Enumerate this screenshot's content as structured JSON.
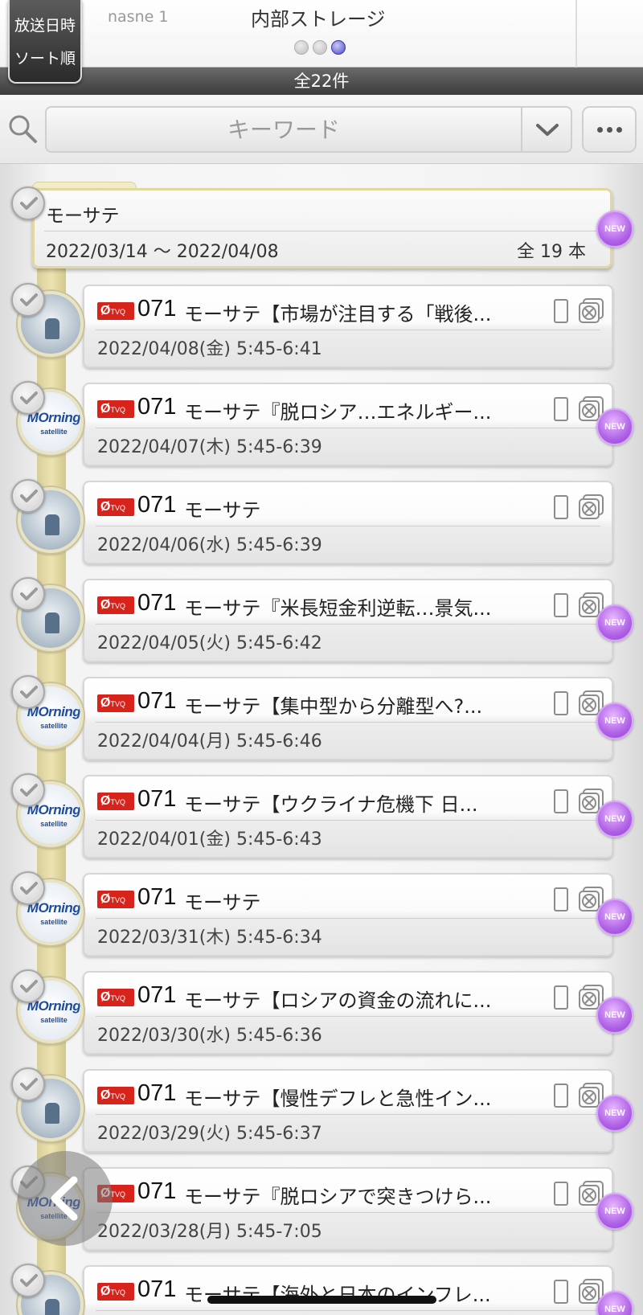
{
  "header": {
    "sort_button_line1": "放送日時",
    "sort_button_line2": "ソート順",
    "source": "nasne 1",
    "storage": "内部ストレージ",
    "total": "全22件"
  },
  "search": {
    "placeholder": "キーワード"
  },
  "colors": {
    "channel_badge": "#d8231b",
    "new_badge": "#b063e6",
    "timeline": "#e2d89f",
    "active_dot": "#4a4bc9"
  },
  "group": {
    "title": "モーサテ",
    "range": "2022/03/14 〜 2022/04/08",
    "count": "全 19 本"
  },
  "badge_new": "NEW",
  "thumb_logo": {
    "main": "MOrning",
    "sub": "satellite"
  },
  "items": [
    {
      "channel": "071",
      "title": "モーサテ【市場が注目する「戦後...",
      "time": "2022/04/08(金) 5:45-6:41",
      "new": false,
      "thumb": "studio"
    },
    {
      "channel": "071",
      "title": "モーサテ『脱ロシア…エネルギー...",
      "time": "2022/04/07(木) 5:45-6:39",
      "new": true,
      "thumb": "logo"
    },
    {
      "channel": "071",
      "title": "モーサテ",
      "time": "2022/04/06(水) 5:45-6:39",
      "new": false,
      "thumb": "studio"
    },
    {
      "channel": "071",
      "title": "モーサテ『米長短金利逆転…景気...",
      "time": "2022/04/05(火) 5:45-6:42",
      "new": true,
      "thumb": "studio"
    },
    {
      "channel": "071",
      "title": "モーサテ【集中型から分離型へ?...",
      "time": "2022/04/04(月) 5:45-6:46",
      "new": true,
      "thumb": "logo"
    },
    {
      "channel": "071",
      "title": "モーサテ【ウクライナ危機下 日...",
      "time": "2022/04/01(金) 5:45-6:43",
      "new": true,
      "thumb": "logo"
    },
    {
      "channel": "071",
      "title": "モーサテ",
      "time": "2022/03/31(木) 5:45-6:34",
      "new": true,
      "thumb": "logo"
    },
    {
      "channel": "071",
      "title": "モーサテ【ロシアの資金の流れに...",
      "time": "2022/03/30(水) 5:45-6:36",
      "new": true,
      "thumb": "logo"
    },
    {
      "channel": "071",
      "title": "モーサテ【慢性デフレと急性イン...",
      "time": "2022/03/29(火) 5:45-6:37",
      "new": true,
      "thumb": "studio"
    },
    {
      "channel": "071",
      "title": "モーサテ『脱ロシアで突きつけら...",
      "time": "2022/03/28(月) 5:45-7:05",
      "new": true,
      "thumb": "logo"
    },
    {
      "channel": "071",
      "title": "モーサテ【海外と日本のインフレ...",
      "time": "",
      "new": true,
      "thumb": "studio"
    }
  ]
}
